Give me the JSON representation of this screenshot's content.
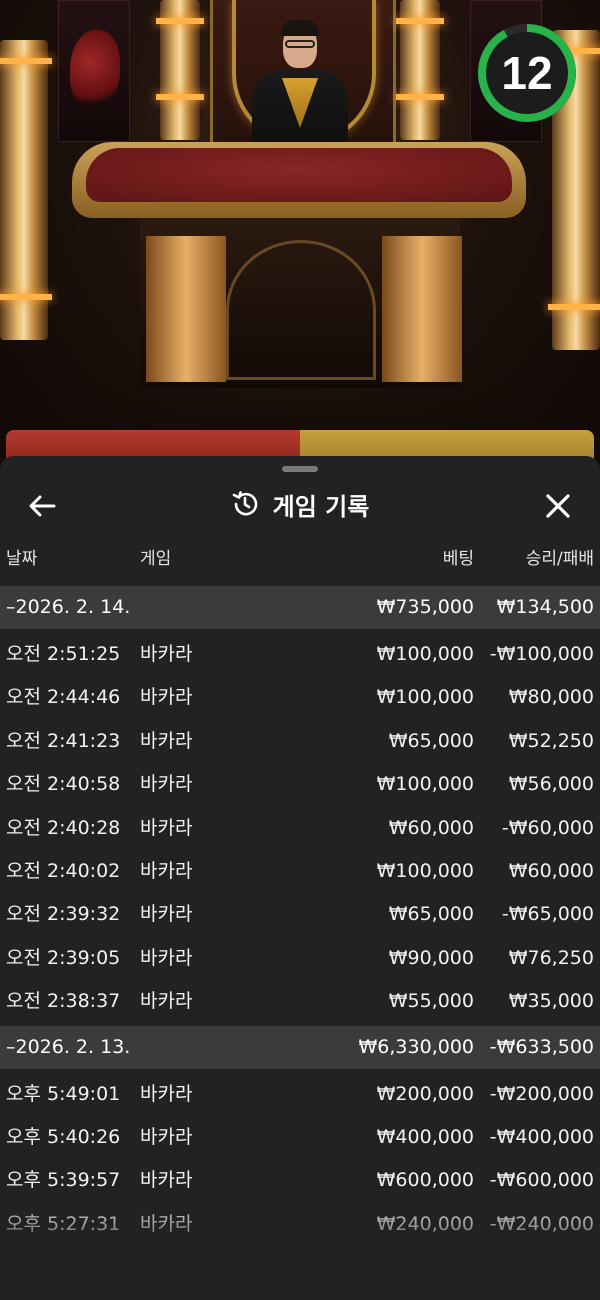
{
  "live_video": {
    "timer_value": "12",
    "timer_fraction": 0.92,
    "colors": {
      "timer_ring": "#27b24a",
      "timer_track": "#2a2a2a"
    }
  },
  "history_panel": {
    "title": "게임 기록",
    "title_icon": "history-icon",
    "back_icon": "arrow-left-icon",
    "close_icon": "close-icon",
    "columns": {
      "date": "날짜",
      "game": "게임",
      "bet": "베팅",
      "win_loss": "승리/패배"
    },
    "groups": [
      {
        "date": "–2026. 2. 14.",
        "total_bet": "₩735,000",
        "total_result": "₩134,500",
        "rows": [
          {
            "time": "오전 2:51:25",
            "game": "바카라",
            "bet": "₩100,000",
            "result": "-₩100,000"
          },
          {
            "time": "오전 2:44:46",
            "game": "바카라",
            "bet": "₩100,000",
            "result": "₩80,000"
          },
          {
            "time": "오전 2:41:23",
            "game": "바카라",
            "bet": "₩65,000",
            "result": "₩52,250"
          },
          {
            "time": "오전 2:40:58",
            "game": "바카라",
            "bet": "₩100,000",
            "result": "₩56,000"
          },
          {
            "time": "오전 2:40:28",
            "game": "바카라",
            "bet": "₩60,000",
            "result": "-₩60,000"
          },
          {
            "time": "오전 2:40:02",
            "game": "바카라",
            "bet": "₩100,000",
            "result": "₩60,000"
          },
          {
            "time": "오전 2:39:32",
            "game": "바카라",
            "bet": "₩65,000",
            "result": "-₩65,000"
          },
          {
            "time": "오전 2:39:05",
            "game": "바카라",
            "bet": "₩90,000",
            "result": "₩76,250"
          },
          {
            "time": "오전 2:38:37",
            "game": "바카라",
            "bet": "₩55,000",
            "result": "₩35,000"
          }
        ]
      },
      {
        "date": "–2026. 2. 13.",
        "total_bet": "₩6,330,000",
        "total_result": "-₩633,500",
        "rows": [
          {
            "time": "오후 5:49:01",
            "game": "바카라",
            "bet": "₩200,000",
            "result": "-₩200,000"
          },
          {
            "time": "오후 5:40:26",
            "game": "바카라",
            "bet": "₩400,000",
            "result": "-₩400,000"
          },
          {
            "time": "오후 5:39:57",
            "game": "바카라",
            "bet": "₩600,000",
            "result": "-₩600,000"
          },
          {
            "time": "오후 5:27:31",
            "game": "바카라",
            "bet": "₩240,000",
            "result": "-₩240,000"
          }
        ]
      }
    ],
    "colors": {
      "panel_bg": "#222222",
      "group_bg": "#3b3b3b",
      "text": "#ffffff"
    }
  }
}
